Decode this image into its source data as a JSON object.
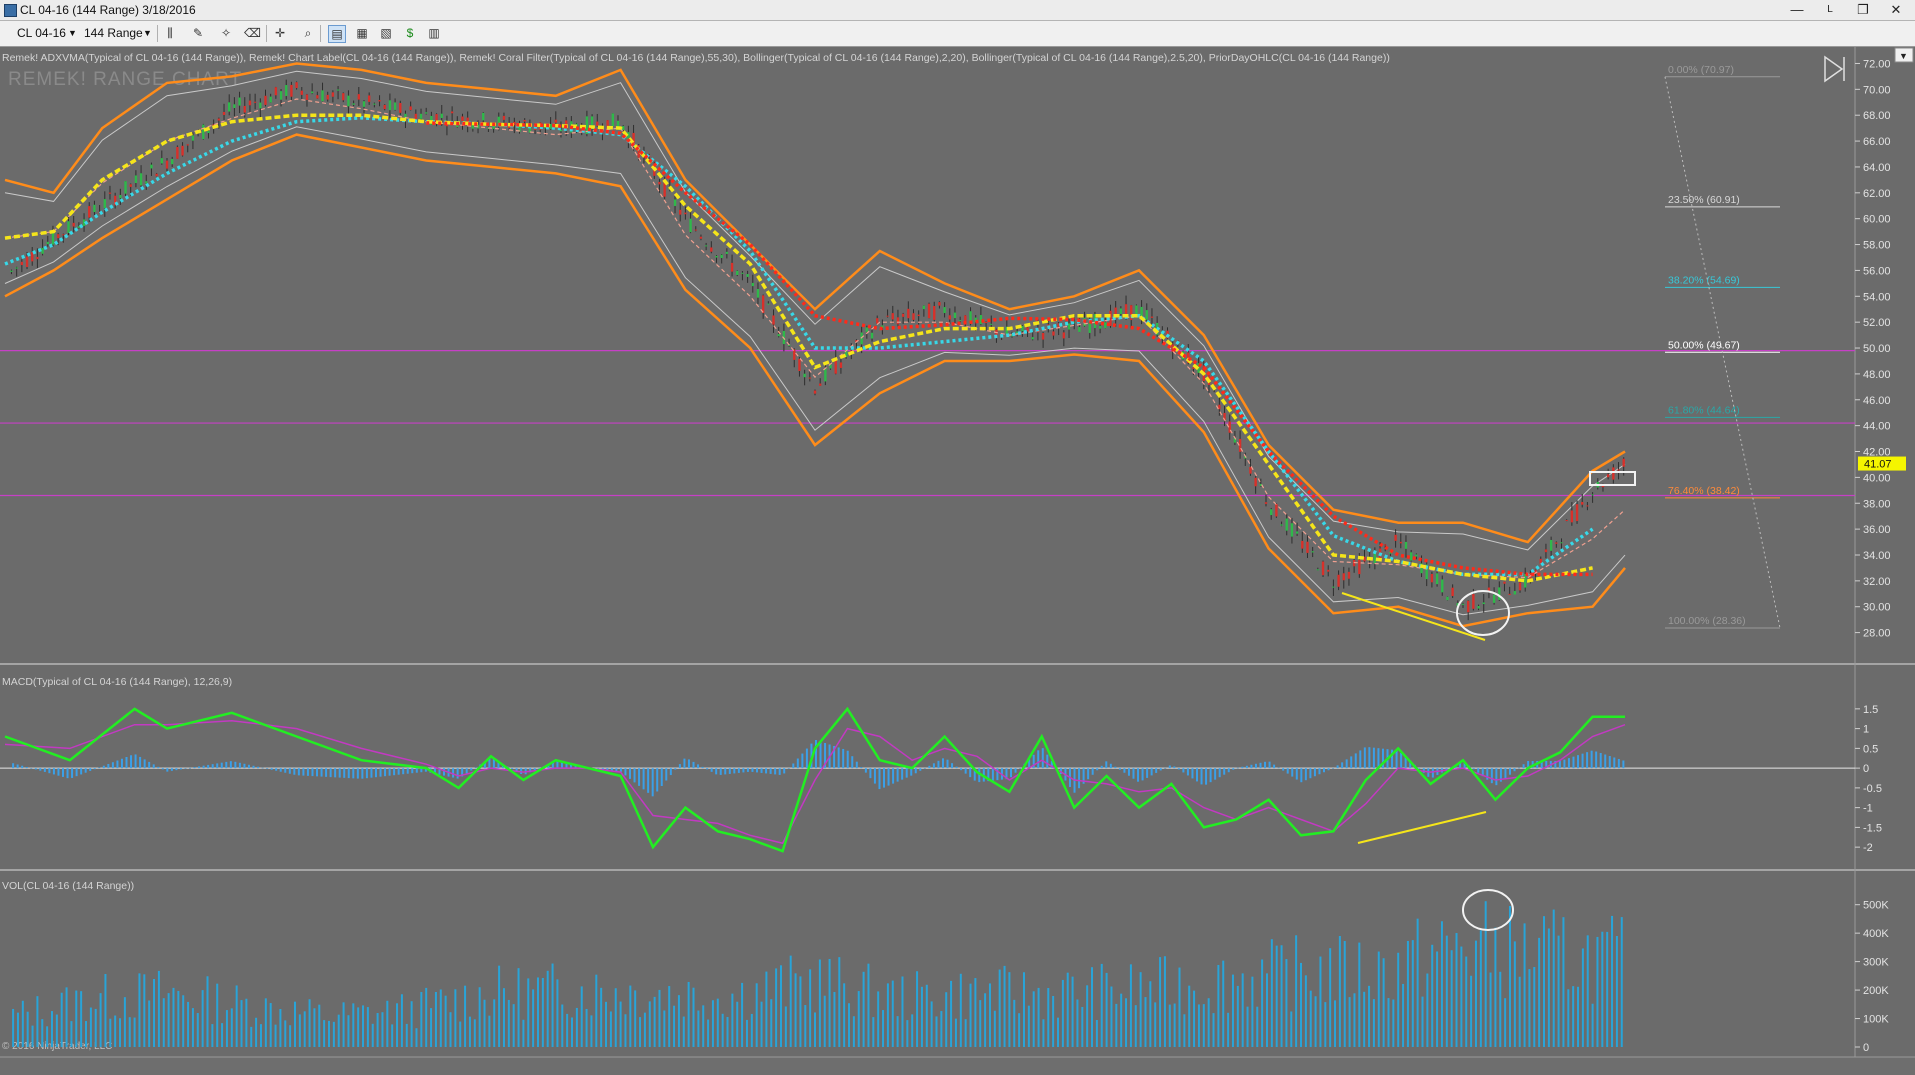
{
  "window": {
    "title": "CL 04-16 (144 Range)  3/18/2016",
    "minimize": "—",
    "restore": "❐",
    "close": "✕",
    "helper": "L"
  },
  "toolbar": {
    "instrument": "CL 04-16",
    "period": "144 Range"
  },
  "panels": {
    "price_label": "Remek! ADXVMA(Typical of CL 04-16 (144 Range)), Remek! Chart Label(CL 04-16 (144 Range)), Remek! Coral Filter(Typical of CL 04-16 (144 Range),55,30), Bollinger(Typical of CL 04-16 (144 Range),2,20), Bollinger(Typical of CL 04-16 (144 Range),2.5,20), PriorDayOHLC(CL 04-16 (144 Range))",
    "watermark": "REMEK! RANGE CHART",
    "macd_label": "MACD(Typical of CL 04-16 (144 Range), 12,26,9)",
    "vol_label": "VOL(CL 04-16 (144 Range))",
    "copyright": "© 2016 NinjaTrader, LLC",
    "last_price": "41.07"
  },
  "chart_data": [
    {
      "type": "line",
      "panel": "price",
      "title": "",
      "ylim": [
        26.5,
        72.5
      ],
      "yticks": [
        72,
        70,
        68,
        66,
        64,
        62,
        60,
        58,
        56,
        54,
        52,
        50,
        48,
        46,
        44,
        42,
        40,
        38,
        36,
        34,
        32,
        30,
        28
      ],
      "ytick_labels": [
        "72.00",
        "70.00",
        "68.00",
        "66.00",
        "64.00",
        "62.00",
        "60.00",
        "58.00",
        "56.00",
        "54.00",
        "52.00",
        "50.00",
        "48.00",
        "46.00",
        "44.00",
        "42.00",
        "40.00",
        "38.00",
        "36.00",
        "34.00",
        "32.00",
        "30.00",
        "28.00"
      ],
      "last_price": 41.07,
      "fibonacci": [
        {
          "label": "0.00% (70.97)",
          "value": 70.97,
          "color": "#9a9a9a"
        },
        {
          "label": "23.50% (60.91)",
          "value": 60.91,
          "color": "#d8d8d8"
        },
        {
          "label": "38.20% (54.69)",
          "value": 54.69,
          "color": "#38c8d8"
        },
        {
          "label": "50.00% (49.67)",
          "value": 49.67,
          "color": "#ffffff"
        },
        {
          "label": "61.80% (44.64)",
          "value": 44.64,
          "color": "#2aa8a8"
        },
        {
          "label": "76.40% (38.42)",
          "value": 38.42,
          "color": "#ff8a3a"
        },
        {
          "label": "100.00% (28.36)",
          "value": 28.36,
          "color": "#9a9a9a"
        }
      ],
      "horizontal_levels": [
        49.8,
        44.2,
        38.6
      ],
      "series": [
        {
          "role": "price",
          "color": "#2a2a2a",
          "x": [
            0,
            3,
            6,
            10,
            14,
            18,
            22,
            26,
            30,
            34,
            38,
            42,
            46,
            50,
            54,
            58,
            62,
            66,
            70,
            74,
            78,
            82,
            86,
            90,
            94,
            98,
            100
          ],
          "values": [
            55.5,
            58.5,
            61.0,
            64.5,
            68.5,
            70.0,
            69.0,
            68.0,
            67.5,
            67.0,
            67.5,
            60.0,
            55.0,
            47.0,
            52.0,
            53.0,
            51.0,
            51.5,
            53.0,
            48.0,
            38.0,
            32.0,
            35.0,
            30.0,
            32.0,
            39.0,
            41.1
          ]
        },
        {
          "role": "bollinger_upper",
          "color": "#ff8c1a",
          "x": [
            0,
            3,
            6,
            10,
            14,
            18,
            22,
            26,
            30,
            34,
            38,
            42,
            46,
            50,
            54,
            58,
            62,
            66,
            70,
            74,
            78,
            82,
            86,
            90,
            94,
            98,
            100
          ],
          "values": [
            63.0,
            62.0,
            67.0,
            70.5,
            71.0,
            72.0,
            71.5,
            70.5,
            70.0,
            69.5,
            71.5,
            63.0,
            58.0,
            53.0,
            57.5,
            55.0,
            53.0,
            54.0,
            56.0,
            51.0,
            42.5,
            37.5,
            36.5,
            36.5,
            35.0,
            40.5,
            42.0
          ]
        },
        {
          "role": "bollinger_lower",
          "color": "#ff8c1a",
          "x": [
            0,
            3,
            6,
            10,
            14,
            18,
            22,
            26,
            30,
            34,
            38,
            42,
            46,
            50,
            54,
            58,
            62,
            66,
            70,
            74,
            78,
            82,
            86,
            90,
            94,
            98,
            100
          ],
          "values": [
            54.0,
            56.0,
            58.5,
            61.5,
            64.5,
            66.5,
            65.5,
            64.5,
            64.0,
            63.5,
            62.5,
            54.5,
            50.0,
            42.5,
            46.5,
            49.0,
            49.0,
            49.5,
            49.0,
            43.5,
            34.5,
            29.5,
            30.0,
            28.5,
            29.5,
            30.0,
            33.0
          ]
        },
        {
          "role": "coral_filter",
          "color": "#ff2a1a",
          "x": [
            26,
            30,
            34,
            38,
            42,
            46,
            50,
            54,
            58,
            62,
            66,
            70,
            74,
            78,
            82,
            86,
            90,
            94,
            98
          ],
          "values": [
            67.4,
            67.3,
            67.2,
            66.6,
            62.0,
            58.0,
            52.5,
            51.5,
            51.8,
            52.3,
            52.2,
            51.5,
            48.5,
            42.0,
            37.0,
            34.0,
            33.0,
            32.5,
            32.5
          ]
        },
        {
          "role": "adxvma",
          "color": "#f5e51a",
          "x": [
            0,
            3,
            6,
            10,
            14,
            18,
            22,
            26,
            30,
            34,
            38,
            42,
            46,
            50,
            54,
            58,
            62,
            66,
            70,
            74,
            78,
            82,
            86,
            90,
            94,
            98
          ],
          "values": [
            58.5,
            59.0,
            63.0,
            66.0,
            67.5,
            68.0,
            68.0,
            67.5,
            67.3,
            67.2,
            67.0,
            61.0,
            56.5,
            48.5,
            50.5,
            51.5,
            51.5,
            52.5,
            52.5,
            48.0,
            41.0,
            34.0,
            33.5,
            32.5,
            32.0,
            33.0
          ]
        },
        {
          "role": "trend_ma",
          "color": "#38d8e8",
          "x": [
            0,
            3,
            6,
            10,
            14,
            18,
            22,
            26,
            30,
            34,
            38,
            42,
            46,
            50,
            54,
            58,
            62,
            66,
            70,
            74,
            78,
            82,
            86,
            90,
            94,
            98
          ],
          "values": [
            56.5,
            58.0,
            60.5,
            63.5,
            66.0,
            67.5,
            67.8,
            67.5,
            67.3,
            67.0,
            66.5,
            62.5,
            57.5,
            50.0,
            50.0,
            50.5,
            51.0,
            52.0,
            52.5,
            49.0,
            42.0,
            35.5,
            33.5,
            32.5,
            32.5,
            36.0
          ]
        }
      ]
    },
    {
      "type": "line",
      "panel": "macd",
      "title": "",
      "ylim": [
        -2.3,
        1.8
      ],
      "yticks": [
        1.5,
        1,
        0.5,
        0,
        -0.5,
        -1,
        -1.5,
        -2
      ],
      "ytick_labels": [
        "1.5",
        "1",
        "0.5",
        "0",
        "-0.5",
        "-1",
        "-1.5",
        "-2"
      ],
      "series": [
        {
          "role": "macd",
          "color": "#22ee22",
          "x": [
            0,
            4,
            8,
            10,
            14,
            18,
            22,
            26,
            28,
            30,
            32,
            34,
            36,
            38,
            40,
            42,
            44,
            46,
            48,
            50,
            52,
            54,
            56,
            58,
            60,
            62,
            64,
            66,
            68,
            70,
            72,
            74,
            76,
            78,
            80,
            82,
            84,
            86,
            88,
            90,
            92,
            94,
            96,
            98,
            100
          ],
          "values": [
            0.8,
            0.2,
            1.5,
            1.0,
            1.4,
            0.8,
            0.2,
            0.0,
            -0.5,
            0.3,
            -0.3,
            0.2,
            0.0,
            -0.2,
            -2.0,
            -1.0,
            -1.6,
            -1.8,
            -2.1,
            0.5,
            1.5,
            0.2,
            0.0,
            0.8,
            -0.1,
            -0.6,
            0.8,
            -1.0,
            -0.2,
            -1.0,
            -0.4,
            -1.5,
            -1.3,
            -0.8,
            -1.7,
            -1.6,
            -0.3,
            0.5,
            -0.4,
            0.2,
            -0.8,
            0.0,
            0.4,
            1.3,
            1.3
          ]
        },
        {
          "role": "signal",
          "color": "#c23ac2",
          "x": [
            0,
            4,
            8,
            10,
            14,
            18,
            22,
            26,
            28,
            30,
            32,
            34,
            36,
            38,
            40,
            42,
            44,
            46,
            48,
            50,
            52,
            54,
            56,
            58,
            60,
            62,
            64,
            66,
            68,
            70,
            72,
            74,
            76,
            78,
            80,
            82,
            84,
            86,
            88,
            90,
            92,
            94,
            96,
            98,
            100
          ],
          "values": [
            0.6,
            0.5,
            1.1,
            1.1,
            1.2,
            1.0,
            0.5,
            0.1,
            -0.2,
            0.0,
            -0.1,
            0.0,
            0.0,
            -0.1,
            -1.2,
            -1.3,
            -1.4,
            -1.7,
            -1.9,
            -0.3,
            1.0,
            0.8,
            0.2,
            0.5,
            0.3,
            -0.3,
            0.2,
            -0.3,
            -0.4,
            -0.6,
            -0.5,
            -1.0,
            -1.3,
            -1.0,
            -1.3,
            -1.6,
            -0.9,
            0.0,
            -0.1,
            0.0,
            -0.3,
            -0.2,
            0.2,
            0.8,
            1.1
          ]
        },
        {
          "role": "histogram",
          "color": "#3aa0e8",
          "x": [
            2,
            6,
            10,
            14,
            18,
            22,
            26,
            30,
            34,
            38,
            42,
            46,
            50,
            54,
            58,
            62,
            66,
            70,
            74,
            78,
            82,
            86,
            90,
            94,
            98
          ],
          "values": [
            0.2,
            -0.3,
            0.2,
            0.3,
            -0.2,
            -0.2,
            0.3,
            -0.2,
            0.2,
            -0.3,
            0.4,
            -0.2,
            0.8,
            -0.3,
            0.3,
            -0.3,
            0.5,
            -0.2,
            0.3,
            -0.3,
            0.3,
            0.5,
            -0.4,
            0.3,
            0.4
          ]
        }
      ]
    },
    {
      "type": "bar",
      "panel": "volume",
      "title": "",
      "ylim": [
        0,
        520000
      ],
      "yticks": [
        500000,
        400000,
        300000,
        200000,
        100000,
        0
      ],
      "ytick_labels": [
        "500K",
        "400K",
        "300K",
        "200K",
        "100K",
        "0"
      ],
      "series": [
        {
          "name": "",
          "color": "#29a4d8",
          "x": [
            0,
            5,
            10,
            15,
            20,
            25,
            30,
            35,
            40,
            45,
            50,
            55,
            60,
            65,
            70,
            75,
            80,
            85,
            90,
            95,
            100
          ],
          "values": [
            140000,
            230000,
            260000,
            200000,
            150000,
            180000,
            260000,
            280000,
            260000,
            250000,
            320000,
            240000,
            260000,
            260000,
            280000,
            320000,
            360000,
            370000,
            490000,
            450000,
            420000
          ]
        }
      ]
    }
  ]
}
